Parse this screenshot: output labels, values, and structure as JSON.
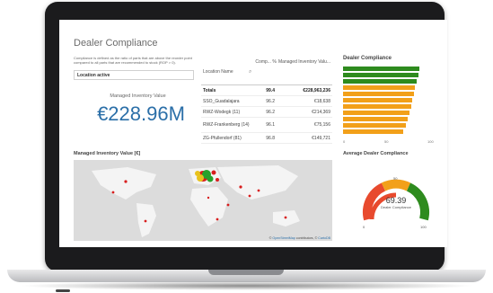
{
  "app": {
    "title": "Dealer Compliance",
    "description": "Compliance is defined as the ratio of parts that are above the reorder point compared to all parts that are recommended to stock (ROP > 0).",
    "filter_value": "Location active"
  },
  "kpi": {
    "label": "Managed Inventory Value",
    "value": "€228.96M"
  },
  "table": {
    "headers": {
      "location": "Location Name",
      "compliance": "Comp... %",
      "inventory": "Managed Inventory Valu..."
    },
    "totals": {
      "label": "Totals",
      "compliance": "99.4",
      "inventory": "€228,963,236"
    },
    "rows": [
      {
        "location": "SSO_Guadalajara",
        "compliance": "96.2",
        "inventory": "€18,638"
      },
      {
        "location": "RWZ-Wodegk (11)",
        "compliance": "96.2",
        "inventory": "€214,369"
      },
      {
        "location": "RWZ-Frankenberg (14)",
        "compliance": "96.1",
        "inventory": "€75,156"
      },
      {
        "location": "ZG-Pfullendorf (81)",
        "compliance": "96.8",
        "inventory": "€149,721"
      }
    ]
  },
  "bar_chart": {
    "title": "Dealer Compliance",
    "axis_ticks": [
      "0",
      "50",
      "100"
    ],
    "bars": [
      {
        "value": 85,
        "color": "#2e8b1e"
      },
      {
        "value": 84,
        "color": "#2e8b1e"
      },
      {
        "value": 82,
        "color": "#2e8b1e"
      },
      {
        "value": 80,
        "color": "#f2a01a"
      },
      {
        "value": 79,
        "color": "#f2a01a"
      },
      {
        "value": 77,
        "color": "#f2a01a"
      },
      {
        "value": 76,
        "color": "#f2a01a"
      },
      {
        "value": 74,
        "color": "#f2a01a"
      },
      {
        "value": 72,
        "color": "#f2a01a"
      },
      {
        "value": 70,
        "color": "#f2a01a"
      },
      {
        "value": 67,
        "color": "#f2a01a"
      }
    ]
  },
  "map": {
    "title": "Managed Inventory Value [€]",
    "attribution_prefix": "©",
    "attribution_osm": "OpenStreetMap",
    "attribution_mid": "contributors, ©",
    "attribution_carto": "CartoDB"
  },
  "gauge": {
    "title": "Average Dealer Compliance",
    "value": "69.39",
    "label": "Dealer Compliance",
    "marker": "50",
    "min": "0",
    "max": "100",
    "level": 0.6939
  }
}
